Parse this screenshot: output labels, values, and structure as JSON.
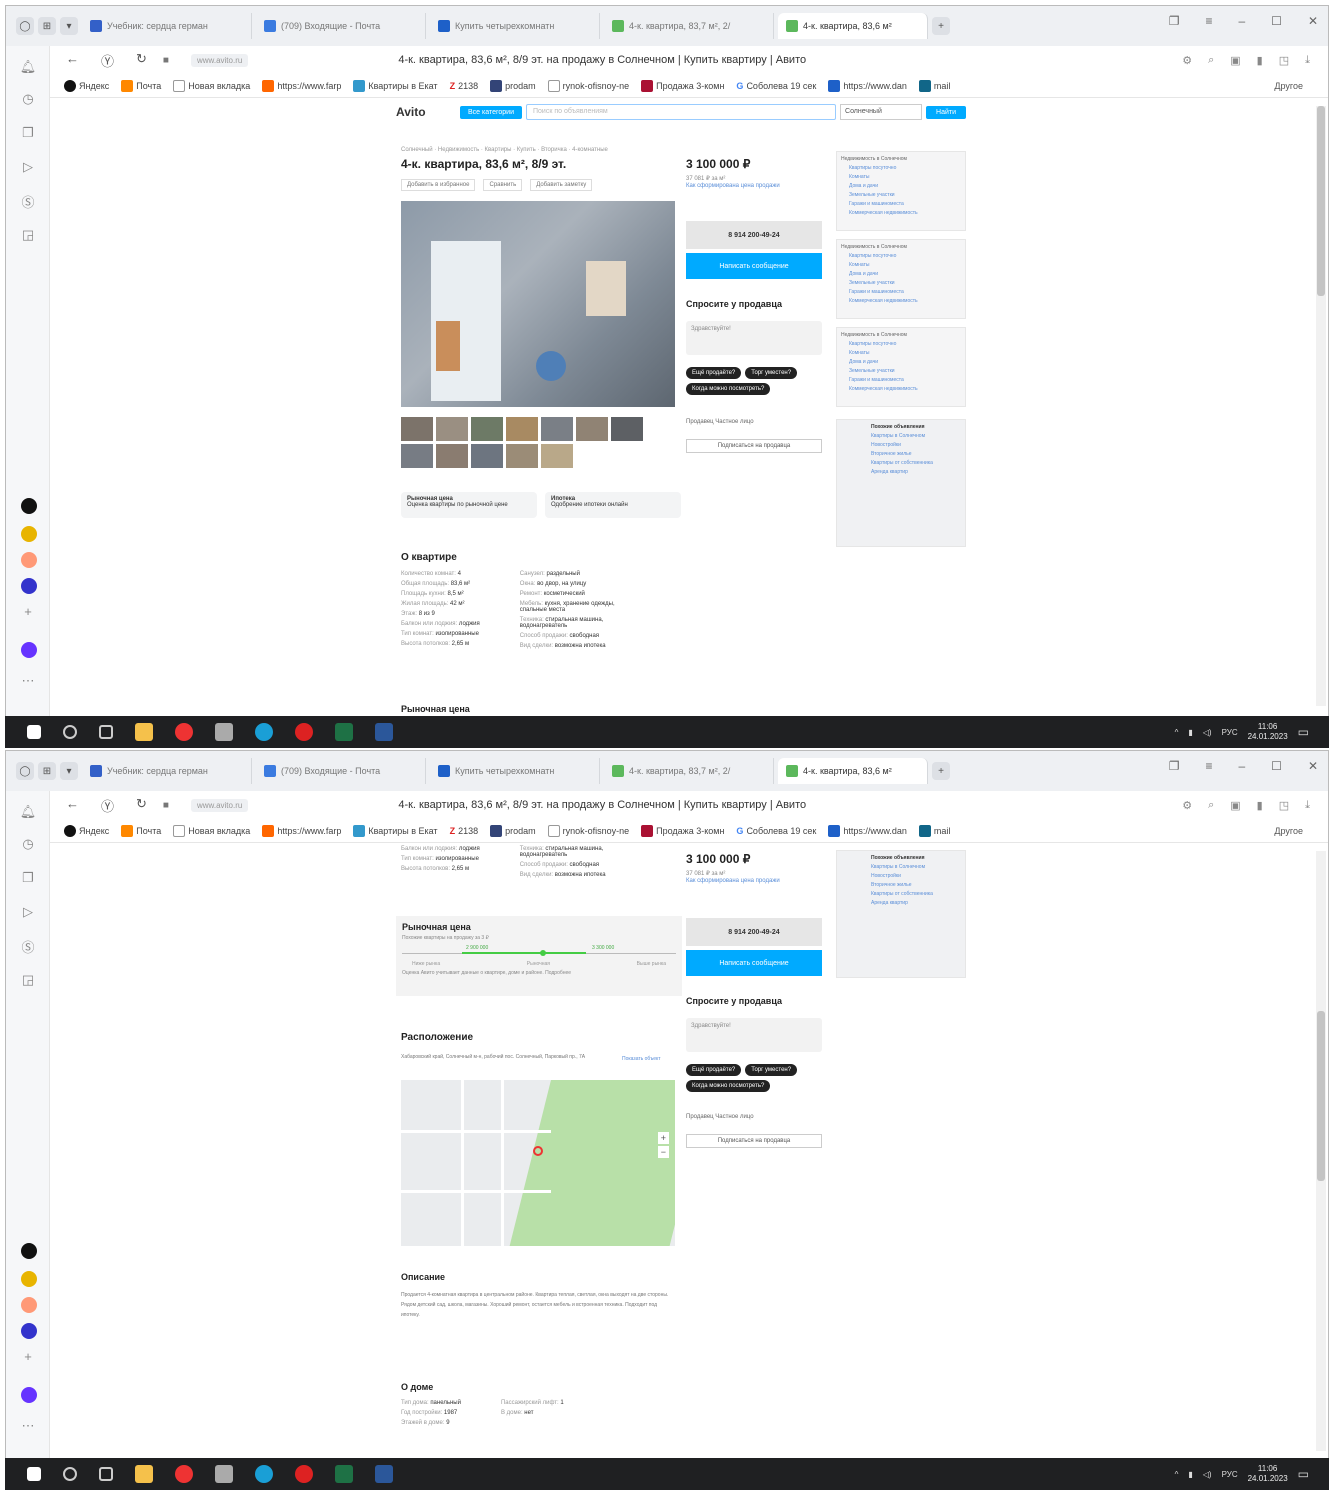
{
  "browser": {
    "tabs": [
      {
        "label": "Учебник: сердца герман",
        "color": "#3360c8"
      },
      {
        "label": "(709) Входящие - Почта",
        "color": "#3b7be0"
      },
      {
        "label": "Купить четырехкомнатн",
        "color": "#1e60c8"
      },
      {
        "label": "4-к. квартира, 83,7 м², 2/",
        "color": "#5cb85c"
      },
      {
        "label": "4-к. квартира, 83,6 м²",
        "color": "#5cb85c"
      }
    ],
    "domain": "www.avito.ru",
    "page_title": "4-к. квартира, 83,6 м², 8/9 эт. на продажу в Солнечном | Купить квартиру | Авито",
    "bookmarks": [
      "Яндекс",
      "Почта",
      "Новая вкладка",
      "https://www.farp",
      "Квартиры в Екат",
      "2138",
      "prodam",
      "rynok-ofisnoy-ne",
      "Продажа 3-комн",
      "Соболева 19 сек",
      "https://www.dan",
      "mail"
    ],
    "other_bookmarks": "Другое"
  },
  "avito": {
    "logo": "Avito",
    "category_btn": "Все категории",
    "search_placeholder": "Поиск по объявлениям",
    "location": "Солнечный",
    "find_btn": "Найти",
    "breadcrumbs": "Солнечный · Недвижимость · Квартиры · Купить · Вторичка · 4-комнатные",
    "title": "4-к. квартира, 83,6 м², 8/9 эт.",
    "actions": [
      "Добавить в избранное",
      "Сравнить",
      "Добавить заметку"
    ],
    "price": "3 100 000 ₽",
    "price_sub": "37 081 ₽ за м²",
    "price_link": "Как сформирована цена продажи",
    "phone": "8 914 200-49-24",
    "write_btn": "Написать сообщение",
    "ask_title": "Спросите у продавца",
    "ask_placeholder": "Здравствуйте!",
    "chips": [
      "Ещё продаёте?",
      "Торг уместен?",
      "Когда можно посмотреть?"
    ],
    "seller_text": "Продавец Частное лицо",
    "seller_btn": "Подписаться на продавца",
    "promo": [
      {
        "title": "Рыночная цена",
        "text": "Оценка квартиры по рыночной цене"
      },
      {
        "title": "Ипотека",
        "text": "Одобрение ипотеки онлайн"
      }
    ],
    "about_title": "О квартире",
    "params_left": [
      {
        "k": "Количество комнат:",
        "v": "4"
      },
      {
        "k": "Общая площадь:",
        "v": "83,6 м²"
      },
      {
        "k": "Площадь кухни:",
        "v": "8,5 м²"
      },
      {
        "k": "Жилая площадь:",
        "v": "42 м²"
      },
      {
        "k": "Этаж:",
        "v": "8 из 9"
      },
      {
        "k": "Балкон или лоджия:",
        "v": "лоджия"
      },
      {
        "k": "Тип комнат:",
        "v": "изолированные"
      },
      {
        "k": "Высота потолков:",
        "v": "2,65 м"
      }
    ],
    "params_right": [
      {
        "k": "Санузел:",
        "v": "раздельный"
      },
      {
        "k": "Окна:",
        "v": "во двор, на улицу"
      },
      {
        "k": "Ремонт:",
        "v": "косметический"
      },
      {
        "k": "Мебель:",
        "v": "кухня, хранение одежды, спальные места"
      },
      {
        "k": "Техника:",
        "v": "стиральная машина, водонагреватель"
      },
      {
        "k": "Способ продажи:",
        "v": "свободная"
      },
      {
        "k": "Вид сделки:",
        "v": "возможна ипотека"
      }
    ],
    "market_title": "Рыночная цена",
    "market_sub": "Похожие квартиры на продажу за 3 ₽",
    "market_low": "2 900 000",
    "market_high": "3 300 000",
    "market_labels": [
      "Ниже рынка",
      "Рыночная",
      "Выше рынка"
    ],
    "market_note": "Оценка Авито учитывает данные о квартире, доме и районе. Подробнее",
    "location_title": "Расположение",
    "address": "Хабаровский край, Солнечный м-н, рабочий пос. Солнечный, Парковый пр., 7А",
    "map_link": "Показать объект",
    "description_title": "Описание",
    "description": "Продается 4-комнатная квартира в центральном районе. Квартира теплая, светлая, окна выходят на две стороны. Рядом детский сад, школа, магазины. Хороший ремонт, остается мебель и встроенная техника. Подходит под ипотеку.",
    "house_title": "О доме",
    "house_left": [
      {
        "k": "Тип дома:",
        "v": "панельный"
      },
      {
        "k": "Год постройки:",
        "v": "1987"
      },
      {
        "k": "Этажей в доме:",
        "v": "9"
      }
    ],
    "house_right": [
      {
        "k": "Пассажирский лифт:",
        "v": "1"
      },
      {
        "k": "В доме:",
        "v": "нет"
      }
    ],
    "ads_title": "Недвижимость в Солнечном",
    "ads_items": [
      "Квартиры посуточно",
      "Комнаты",
      "Дома и дачи",
      "Земельные участки",
      "Гаражи и машиноместа",
      "Коммерческая недвижимость"
    ],
    "sidebar_widget_title": "Похожие объявления",
    "sidebar_widget_items": [
      "Квартиры в Солнечном",
      "Новостройки",
      "Вторичное жилье",
      "Квартиры от собственника",
      "Аренда квартир"
    ]
  },
  "taskbar": {
    "lang": "РУС",
    "time": "11:06",
    "date": "24.01.2023"
  },
  "colors": {
    "avito_blue": "#00aaff",
    "taskbar": "#1f2022"
  }
}
